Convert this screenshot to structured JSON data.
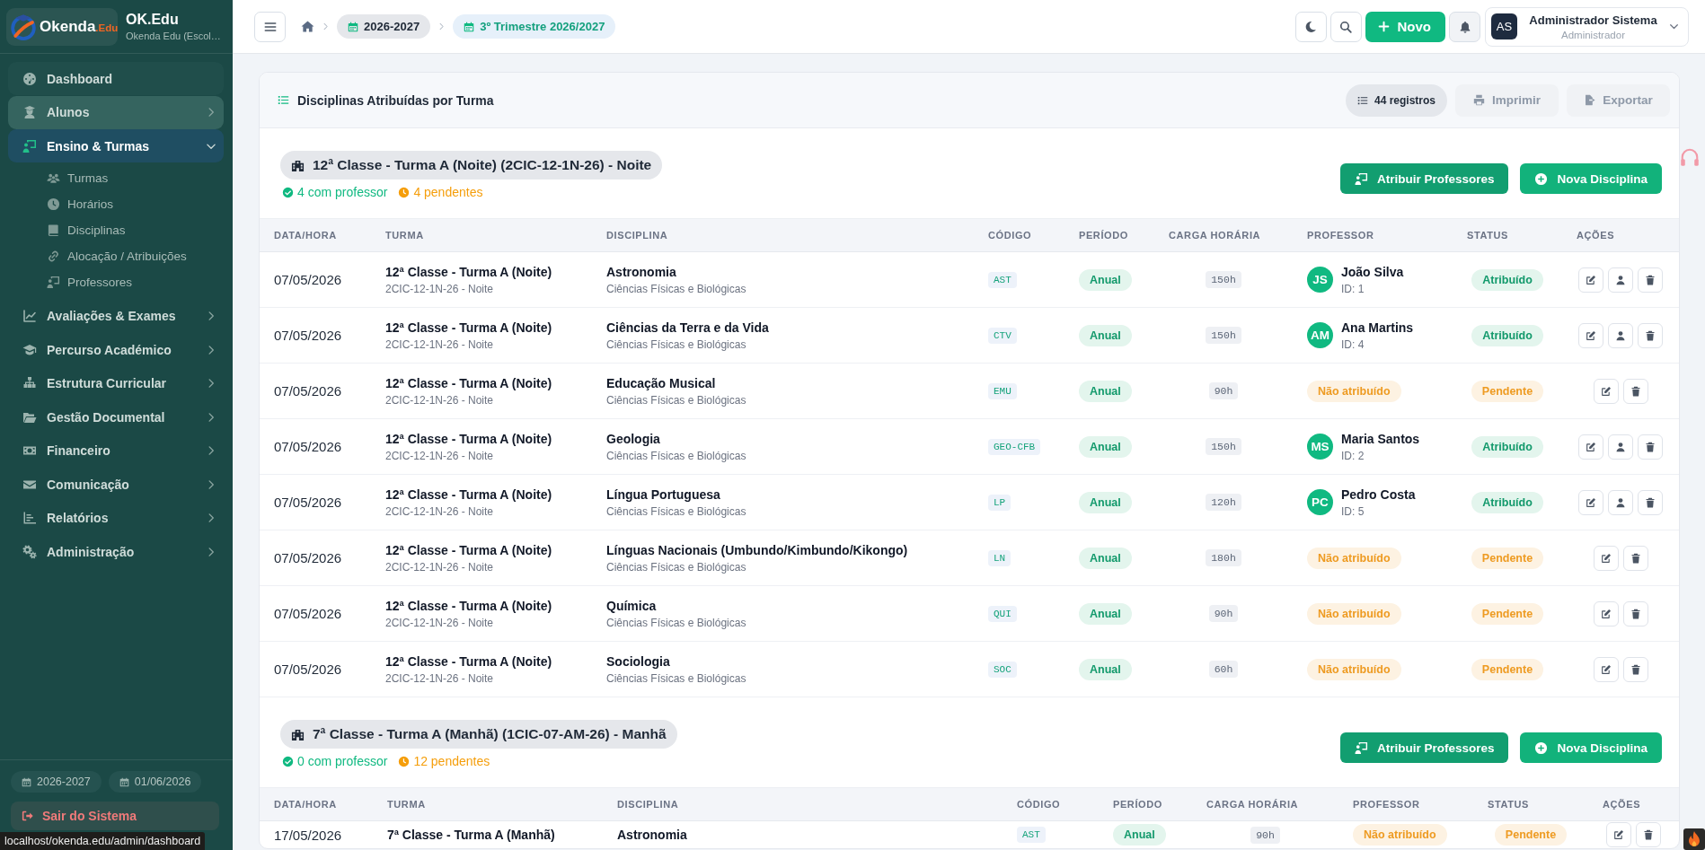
{
  "sidebar": {
    "logo": {
      "name": "Okenda",
      "suffix": ".Edu"
    },
    "title": "OK.Edu",
    "subtitle": "Okenda Edu (Escol…",
    "menu": [
      {
        "label": "Dashboard",
        "kind": "link",
        "selected": false,
        "hovered": false
      },
      {
        "label": "Alunos",
        "kind": "group",
        "selected": false,
        "hovered": true,
        "expanded": false
      },
      {
        "label": "Ensino & Turmas",
        "kind": "group",
        "selected": true,
        "hovered": false,
        "expanded": true,
        "children": [
          {
            "label": "Turmas",
            "selected": false
          },
          {
            "label": "Horários",
            "selected": false
          },
          {
            "label": "Disciplinas",
            "selected": false
          },
          {
            "label": "Alocação / Atribuições",
            "selected": false
          },
          {
            "label": "Professores",
            "selected": false
          }
        ]
      },
      {
        "label": "Avaliações & Exames",
        "kind": "group",
        "selected": false,
        "hovered": false,
        "expanded": false
      },
      {
        "label": "Percurso Académico",
        "kind": "group",
        "selected": false,
        "hovered": false,
        "expanded": false
      },
      {
        "label": "Estrutura Curricular",
        "kind": "group",
        "selected": false,
        "hovered": false,
        "expanded": false
      },
      {
        "label": "Gestão Documental",
        "kind": "group",
        "selected": false,
        "hovered": false,
        "expanded": false
      },
      {
        "label": "Financeiro",
        "kind": "group",
        "selected": false,
        "hovered": false,
        "expanded": false
      },
      {
        "label": "Comunicação",
        "kind": "group",
        "selected": false,
        "hovered": false,
        "expanded": false
      },
      {
        "label": "Relatórios",
        "kind": "group",
        "selected": false,
        "hovered": false,
        "expanded": false
      },
      {
        "label": "Administração",
        "kind": "group",
        "selected": false,
        "hovered": false,
        "expanded": false
      }
    ],
    "footer": {
      "chips": [
        "2026-2027",
        "01/06/2026"
      ],
      "logout": "Sair do Sistema"
    }
  },
  "topbar": {
    "breadcrumb": [
      {
        "label": "2026-2027",
        "selected": false
      },
      {
        "label": "3º Trimestre 2026/2027",
        "selected": true
      }
    ],
    "new_button": "Novo",
    "user": {
      "initials": "AS",
      "name": "Administrador Sistema",
      "role": "Administrador"
    }
  },
  "card": {
    "title": "Disciplinas Atribuídas por Turma",
    "count": "44 registros",
    "actions": [
      {
        "label": "Imprimir",
        "disabled": true
      },
      {
        "label": "Exportar",
        "disabled": true
      }
    ],
    "groups": [
      {
        "title": "12ª Classe - Turma A (Noite) (2CIC-12-1N-26) - Noite",
        "summary": [
          {
            "label": "4 com professor",
            "kind": "assigned"
          },
          {
            "label": "4 pendentes",
            "kind": "pending"
          }
        ],
        "buttons": [
          {
            "label": "Atribuir Professores",
            "kind": "assign"
          },
          {
            "label": "Nova Disciplina",
            "kind": "add"
          }
        ],
        "columns": [
          "DATA/HORA",
          "TURMA",
          "DISCIPLINA",
          "CÓDIGO",
          "PERÍODO",
          "CARGA HORÁRIA",
          "PROFESSOR",
          "STATUS",
          "AÇÕES"
        ],
        "rows": [
          {
            "date": "07/05/2026",
            "turma": "12ª Classe - Turma A (Noite)",
            "turma_code": "2CIC-12-1N-26 - Noite",
            "disciplina": "Astronomia",
            "area": "Ciências Físicas e Biológicas",
            "codigo": "AST",
            "periodo": "Anual",
            "carga": "150h",
            "professor": {
              "assigned": true,
              "initials": "JS",
              "name": "João Silva",
              "id": "ID: 1"
            },
            "status": {
              "label": "Atribuído",
              "kind": "assigned"
            }
          },
          {
            "date": "07/05/2026",
            "turma": "12ª Classe - Turma A (Noite)",
            "turma_code": "2CIC-12-1N-26 - Noite",
            "disciplina": "Ciências da Terra e da Vida",
            "area": "Ciências Físicas e Biológicas",
            "codigo": "CTV",
            "periodo": "Anual",
            "carga": "150h",
            "professor": {
              "assigned": true,
              "initials": "AM",
              "name": "Ana Martins",
              "id": "ID: 4"
            },
            "status": {
              "label": "Atribuído",
              "kind": "assigned"
            }
          },
          {
            "date": "07/05/2026",
            "turma": "12ª Classe - Turma A (Noite)",
            "turma_code": "2CIC-12-1N-26 - Noite",
            "disciplina": "Educação Musical",
            "area": "Ciências Físicas e Biológicas",
            "codigo": "EMU",
            "periodo": "Anual",
            "carga": "90h",
            "professor": {
              "assigned": false,
              "label": "Não atribuído"
            },
            "status": {
              "label": "Pendente",
              "kind": "pending"
            }
          },
          {
            "date": "07/05/2026",
            "turma": "12ª Classe - Turma A (Noite)",
            "turma_code": "2CIC-12-1N-26 - Noite",
            "disciplina": "Geologia",
            "area": "Ciências Físicas e Biológicas",
            "codigo": "GEO-CFB",
            "periodo": "Anual",
            "carga": "150h",
            "professor": {
              "assigned": true,
              "initials": "MS",
              "name": "Maria Santos",
              "id": "ID: 2"
            },
            "status": {
              "label": "Atribuído",
              "kind": "assigned"
            }
          },
          {
            "date": "07/05/2026",
            "turma": "12ª Classe - Turma A (Noite)",
            "turma_code": "2CIC-12-1N-26 - Noite",
            "disciplina": "Língua Portuguesa",
            "area": "Ciências Físicas e Biológicas",
            "codigo": "LP",
            "periodo": "Anual",
            "carga": "120h",
            "professor": {
              "assigned": true,
              "initials": "PC",
              "name": "Pedro Costa",
              "id": "ID: 5"
            },
            "status": {
              "label": "Atribuído",
              "kind": "assigned"
            }
          },
          {
            "date": "07/05/2026",
            "turma": "12ª Classe - Turma A (Noite)",
            "turma_code": "2CIC-12-1N-26 - Noite",
            "disciplina": "Línguas Nacionais (Umbundo/Kimbundo/Kikongo)",
            "area": "Ciências Físicas e Biológicas",
            "codigo": "LN",
            "periodo": "Anual",
            "carga": "180h",
            "professor": {
              "assigned": false,
              "label": "Não atribuído"
            },
            "status": {
              "label": "Pendente",
              "kind": "pending"
            }
          },
          {
            "date": "07/05/2026",
            "turma": "12ª Classe - Turma A (Noite)",
            "turma_code": "2CIC-12-1N-26 - Noite",
            "disciplina": "Química",
            "area": "Ciências Físicas e Biológicas",
            "codigo": "QUI",
            "periodo": "Anual",
            "carga": "90h",
            "professor": {
              "assigned": false,
              "label": "Não atribuído"
            },
            "status": {
              "label": "Pendente",
              "kind": "pending"
            }
          },
          {
            "date": "07/05/2026",
            "turma": "12ª Classe - Turma A (Noite)",
            "turma_code": "2CIC-12-1N-26 - Noite",
            "disciplina": "Sociologia",
            "area": "Ciências Físicas e Biológicas",
            "codigo": "SOC",
            "periodo": "Anual",
            "carga": "60h",
            "professor": {
              "assigned": false,
              "label": "Não atribuído"
            },
            "status": {
              "label": "Pendente",
              "kind": "pending"
            }
          }
        ]
      },
      {
        "title": "7ª Classe - Turma A (Manhã) (1CIC-07-AM-26) - Manhã",
        "summary": [
          {
            "label": "0 com professor",
            "kind": "assigned"
          },
          {
            "label": "12 pendentes",
            "kind": "pending"
          }
        ],
        "buttons": [
          {
            "label": "Atribuir Professores",
            "kind": "assign"
          },
          {
            "label": "Nova Disciplina",
            "kind": "add"
          }
        ],
        "columns": [
          "DATA/HORA",
          "TURMA",
          "DISCIPLINA",
          "CÓDIGO",
          "PERÍODO",
          "CARGA HORÁRIA",
          "PROFESSOR",
          "STATUS",
          "AÇÕES"
        ],
        "rows": [
          {
            "date": "17/05/2026",
            "turma": "7ª Classe - Turma A (Manhã)",
            "disciplina": "Astronomia",
            "codigo": "AST",
            "periodo": "Anual",
            "carga": "90h",
            "professor": {
              "assigned": false,
              "label": "Não atribuído"
            },
            "status": {
              "label": "Pendente",
              "kind": "pending"
            }
          }
        ]
      }
    ]
  },
  "browser_status": "localhost/okenda.edu/admin/dashboard"
}
